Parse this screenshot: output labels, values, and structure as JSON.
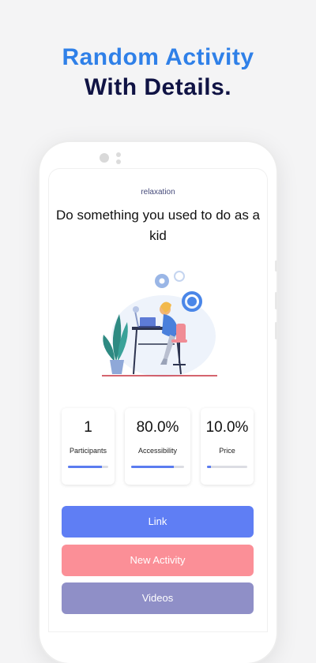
{
  "headline": {
    "line1": "Random Activity",
    "line2": "With Details."
  },
  "activity": {
    "category": "relaxation",
    "title": "Do something you used to do as a kid"
  },
  "stats": [
    {
      "value": "1",
      "label": "Participants",
      "fill": 0.85
    },
    {
      "value": "80.0%",
      "label": "Accessibility",
      "fill": 0.8
    },
    {
      "value": "10.0%",
      "label": "Price",
      "fill": 0.1
    }
  ],
  "buttons": {
    "link": "Link",
    "new_activity": "New Activity",
    "videos": "Videos"
  },
  "colors": {
    "accent_blue": "#2f80e8",
    "link_button": "#5f7ef4",
    "new_activity_button": "#fb8f97",
    "videos_button": "#8f8fc7",
    "progress_fill": "#5b7cf0"
  },
  "illustration": "person-at-desk-tired-with-gears-and-plant"
}
